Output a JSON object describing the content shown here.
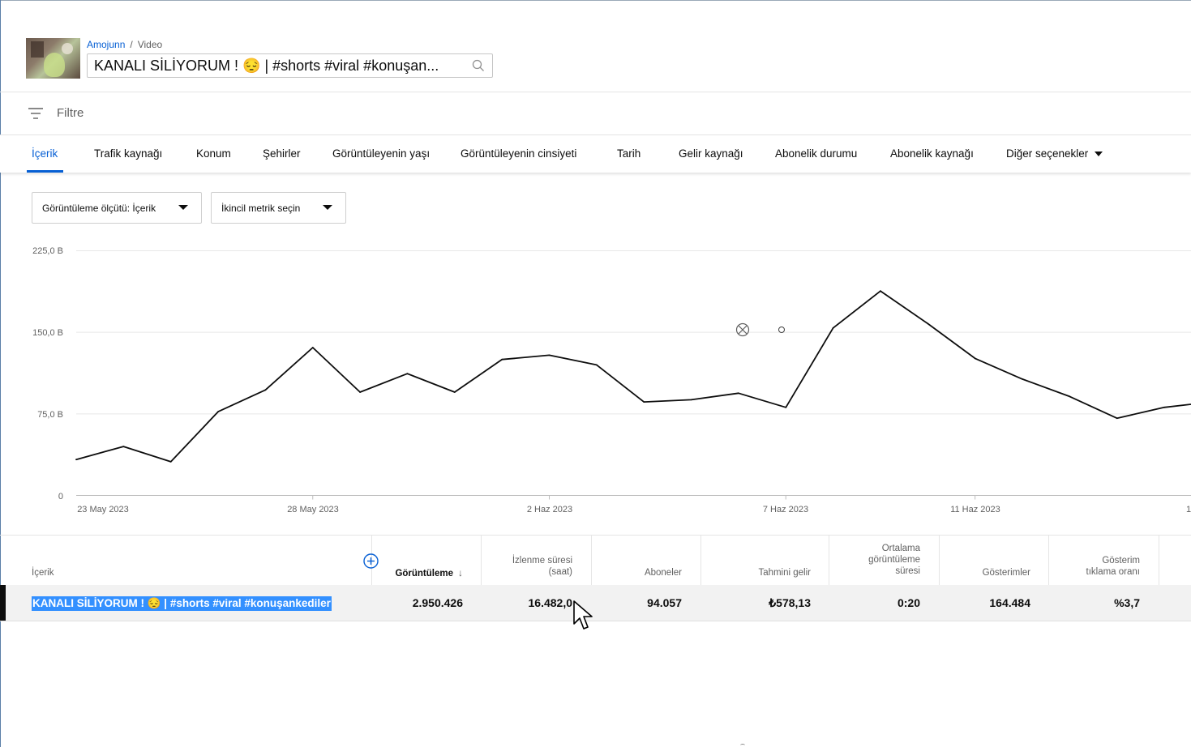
{
  "header": {
    "breadcrumb_channel": "Amojunn",
    "breadcrumb_separator": "/",
    "breadcrumb_page": "Video",
    "video_title": "KANALI SİLİYORUM ! 😔 | #shorts #viral #konuşan..."
  },
  "filter": {
    "label": "Filtre"
  },
  "tabs": [
    {
      "label": "İçerik",
      "active": true
    },
    {
      "label": "Trafik kaynağı"
    },
    {
      "label": "Konum"
    },
    {
      "label": "Şehirler"
    },
    {
      "label": "Görüntüleyenin yaşı"
    },
    {
      "label": "Görüntüleyenin cinsiyeti"
    },
    {
      "label": "Tarih"
    },
    {
      "label": "Gelir kaynağı"
    },
    {
      "label": "Abonelik durumu"
    },
    {
      "label": "Abonelik kaynağı"
    },
    {
      "label": "Diğer seçenekler"
    }
  ],
  "dropdowns": {
    "metric": "Görüntüleme ölçütü: İçerik",
    "secondary": "İkincil metrik seçin"
  },
  "chart_data": {
    "type": "line",
    "y_ticks": [
      "225,0 B",
      "150,0 B",
      "75,0 B",
      "0"
    ],
    "ylim": [
      0,
      225
    ],
    "x_tick_labels": [
      "23 May 2023",
      "28 May 2023",
      "2 Haz 2023",
      "7 Haz 2023",
      "11 Haz 2023",
      "1"
    ],
    "x": [
      "23 May 2023",
      "24 May 2023",
      "25 May 2023",
      "26 May 2023",
      "27 May 2023",
      "28 May 2023",
      "29 May 2023",
      "30 May 2023",
      "31 May 2023",
      "1 Haz 2023",
      "2 Haz 2023",
      "3 Haz 2023",
      "4 Haz 2023",
      "5 Haz 2023",
      "6 Haz 2023",
      "7 Haz 2023",
      "8 Haz 2023",
      "9 Haz 2023",
      "10 Haz 2023",
      "11 Haz 2023",
      "12 Haz 2023",
      "13 Haz 2023",
      "14 Haz 2023",
      "15 Haz 2023",
      "16 Haz 2023"
    ],
    "series": [
      {
        "values": [
          33,
          45,
          31,
          77,
          97,
          136,
          95,
          112,
          95,
          125,
          129,
          120,
          86,
          88,
          94,
          81,
          154,
          188,
          158,
          126,
          107,
          91,
          71,
          81,
          86
        ]
      }
    ],
    "grid": true,
    "color": "#0d0d0d"
  },
  "table": {
    "columns": [
      {
        "label": "İçerik"
      },
      {
        "label": "Görüntüleme",
        "sort": "↓"
      },
      {
        "label1": "İzlenme süresi",
        "label2": "(saat)"
      },
      {
        "label": "Aboneler"
      },
      {
        "label": "Tahmini gelir"
      },
      {
        "label1": "Ortalama",
        "label2": "görüntüleme",
        "label3": "süresi"
      },
      {
        "label": "Gösterimler"
      },
      {
        "label1": "Gösterim",
        "label2": "tıklama oranı"
      }
    ],
    "row": {
      "title": "KANALI SİLİYORUM ! 😔 | #shorts #viral #konuşankediler",
      "views": "2.950.426",
      "watch_time": "16.482,0",
      "subscribers": "94.057",
      "revenue": "₺578,13",
      "avg_duration": "0:20",
      "impressions": "164.484",
      "ctr": "%3,7"
    }
  }
}
